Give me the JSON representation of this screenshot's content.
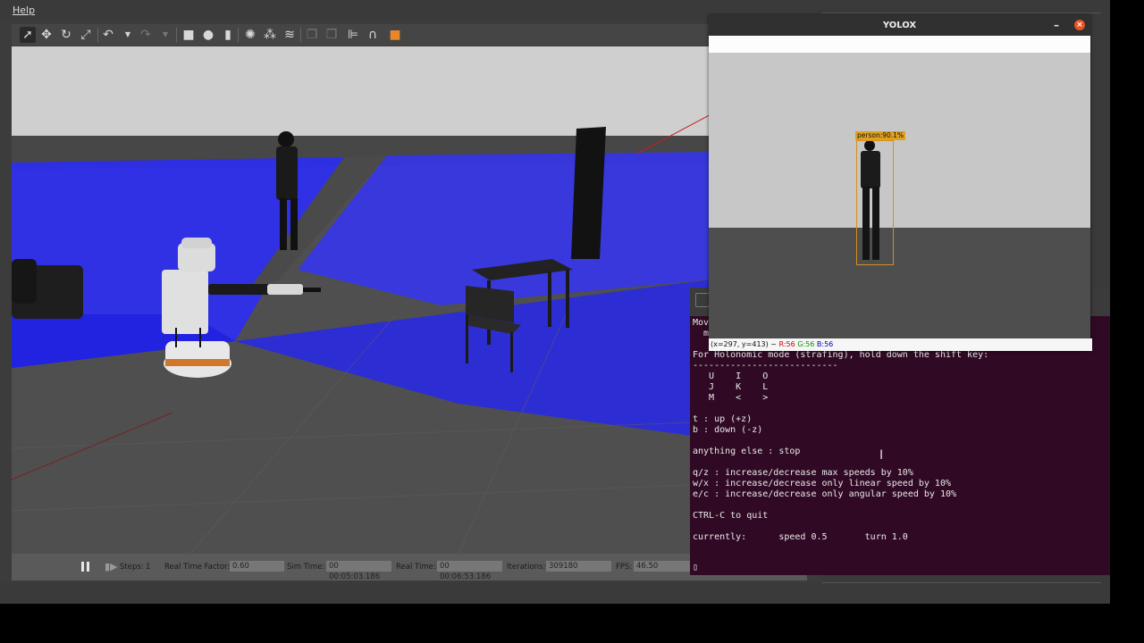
{
  "gazebo": {
    "menu": {
      "help": "Help"
    },
    "toolbar_icons": [
      "select-arrow",
      "translate",
      "rotate",
      "scale",
      "undo",
      "undo-dropdown",
      "redo",
      "redo-dropdown",
      "box",
      "sphere",
      "cylinder",
      "point-light",
      "spot-light",
      "directional-light",
      "copy",
      "paste",
      "align",
      "snap",
      "change-view"
    ],
    "status": {
      "steps_label": "Steps:",
      "steps_value": "1",
      "real_time_factor_label": "Real Time Factor:",
      "real_time_factor_value": "0.60",
      "sim_time_label": "Sim Time:",
      "sim_time_value": "00 00:05:03.186",
      "real_time_label": "Real Time:",
      "real_time_value": "00 00:06:53.186",
      "iterations_label": "Iterations:",
      "iterations_value": "309180",
      "fps_label": "FPS:",
      "fps_value": "46.50"
    }
  },
  "yolox": {
    "title": "YOLOX",
    "minimize": "–",
    "close": "×",
    "detection_label": "person:90.1%",
    "status": {
      "coords": "(x=297, y=413) ~",
      "r": "R:56",
      "g": "G:56",
      "b": "B:56"
    }
  },
  "terminal": {
    "lines": "Mov\n  m    ,    .\n\nFor Holonomic mode (strafing), hold down the shift key:\n---------------------------\n   U    I    O\n   J    K    L\n   M    <    >\n\nt : up (+z)\nb : down (-z)\n\nanything else : stop\n\nq/z : increase/decrease max speeds by 10%\nw/x : increase/decrease only linear speed by 10%\ne/c : increase/decrease only angular speed by 10%\n\nCTRL-C to quit\n\ncurrently:      speed 0.5       turn 1.0",
    "cursor": "▯"
  },
  "colors": {
    "laser_blue": "#2a2aff",
    "terminal_bg": "#300a24",
    "detection_box": "#d49020",
    "close_button": "#e95420"
  }
}
